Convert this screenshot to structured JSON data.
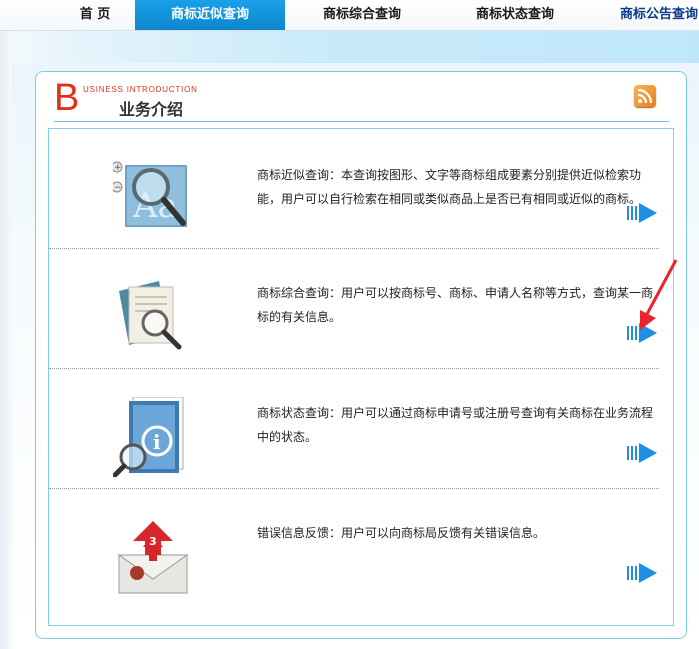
{
  "nav": {
    "items": [
      {
        "label": "首 页"
      },
      {
        "label": "商标近似查询"
      },
      {
        "label": "商标综合查询"
      },
      {
        "label": "商标状态查询"
      },
      {
        "label": "商标公告查询"
      }
    ]
  },
  "panel": {
    "header_letter": "B",
    "header_subtitle": "USINESS INTRODUCTION",
    "title": "业务介绍"
  },
  "services": [
    {
      "description": "商标近似查询：本查询按图形、文字等商标组成要素分别提供近似检索功能，用户可以自行检索在相同或类似商品上是否已有相同或近似的商标。"
    },
    {
      "description": "商标综合查询：用户可以按商标号、商标、申请人名称等方式，查询某一商标的有关信息。"
    },
    {
      "description": "商标状态查询：用户可以通过商标申请号或注册号查询有关商标在业务流程中的状态。"
    },
    {
      "description": "错误信息反馈：用户可以向商标局反馈有关错误信息。",
      "badge": "3"
    }
  ],
  "colors": {
    "nav_active": "#1aa0e8",
    "accent_red": "#e03017",
    "panel_border": "#7ccbe4",
    "arrow_blue": "#1f8fe6"
  },
  "icons": [
    "magnifier-text-icon",
    "document-magnifier-icon",
    "info-book-magnifier-icon",
    "mail-upload-icon",
    "rss-icon",
    "forward-arrow-icon"
  ]
}
